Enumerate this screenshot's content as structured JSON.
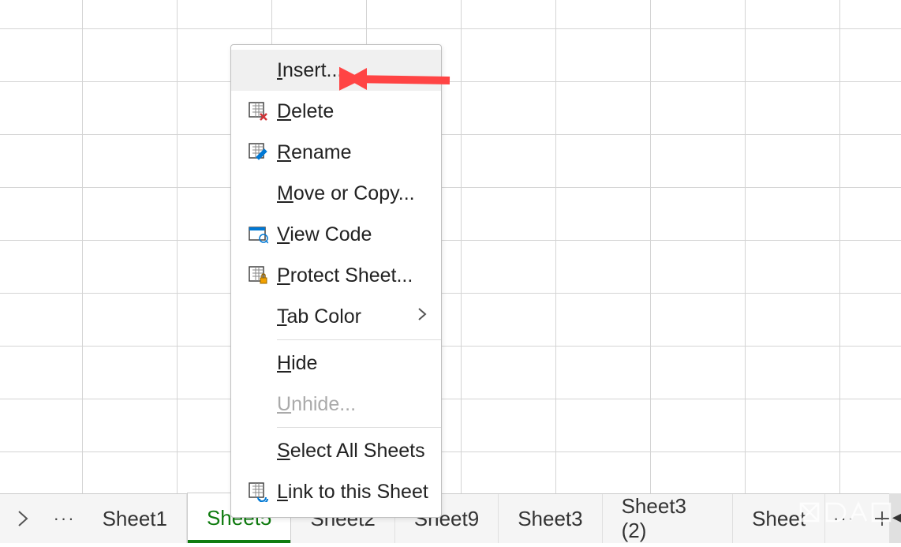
{
  "menu": {
    "insert": "Insert...",
    "delete": "Delete",
    "rename": "Rename",
    "moveCopy": "Move or Copy...",
    "viewCode": "View Code",
    "protect": "Protect Sheet...",
    "tabColor": "Tab Color",
    "hide": "Hide",
    "unhide": "Unhide...",
    "selectAll": "Select All Sheets",
    "link": "Link to this Sheet"
  },
  "tabs": {
    "t1": "Sheet1",
    "active": "Sheet5",
    "t2": "Sheet2",
    "t9": "Sheet9",
    "t3": "Sheet3",
    "t32": "Sheet3 (2)",
    "t_cut": "Sheet"
  }
}
